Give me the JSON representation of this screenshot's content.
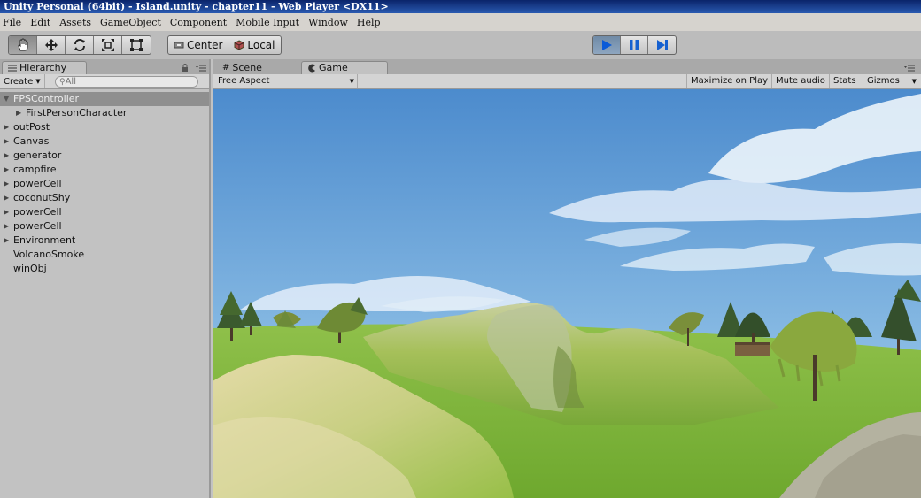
{
  "window": {
    "title": "Unity Personal (64bit) - Island.unity - chapter11 - Web Player <DX11>"
  },
  "menu": [
    "File",
    "Edit",
    "Assets",
    "GameObject",
    "Component",
    "Mobile Input",
    "Window",
    "Help"
  ],
  "toolbar": {
    "center_label": "Center",
    "local_label": "Local"
  },
  "hierarchy": {
    "tab_label": "Hierarchy",
    "create_label": "Create",
    "search_placeholder": "All",
    "items": [
      {
        "label": "FPSController",
        "expanded": true,
        "selected": true
      },
      {
        "label": "FirstPersonCharacter",
        "child": true
      },
      {
        "label": "outPost"
      },
      {
        "label": "Canvas"
      },
      {
        "label": "generator"
      },
      {
        "label": "campfire"
      },
      {
        "label": "powerCell"
      },
      {
        "label": "coconutShy"
      },
      {
        "label": "powerCell"
      },
      {
        "label": "powerCell"
      },
      {
        "label": "Environment"
      },
      {
        "label": "VolcanoSmoke"
      },
      {
        "label": "winObj"
      }
    ]
  },
  "game": {
    "scene_tab": "Scene",
    "game_tab": "Game",
    "aspect": "Free Aspect",
    "maximize": "Maximize on Play",
    "mute": "Mute audio",
    "stats": "Stats",
    "gizmos": "Gizmos",
    "sky_top": "#4c8bcd",
    "sky_bottom": "#b3d6ef",
    "grass": "#7fb33a"
  }
}
